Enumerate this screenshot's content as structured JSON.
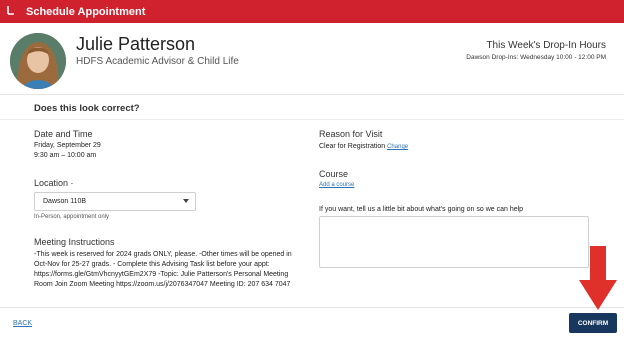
{
  "header": {
    "back_icon": "back-arrow-icon",
    "title": "Schedule Appointment",
    "color": "#d0222e"
  },
  "advisor": {
    "name": "Julie Patterson",
    "role": "HDFS Academic Advisor & Child Life",
    "drop_in_title": "This Week's Drop-In Hours",
    "drop_in_detail": "Dawson Drop-Ins: Wednesday 10:00 - 12:00 PM"
  },
  "confirm_question": "Does this look correct?",
  "date_time": {
    "label": "Date and Time",
    "date": "Friday, September 29",
    "time": "9:30 am – 10:00 am"
  },
  "location": {
    "label": "Location ·",
    "selected": "Dawson 110B",
    "note": "In-Person, appointment only"
  },
  "meeting_instructions": {
    "label": "Meeting Instructions",
    "lines": [
      "-This week is reserved for 2024 grads ONLY, please. -Other times will be opened in",
      "Oct-Nov for 25-27 grads. - Complete this Advising Task list before your appt:",
      "https://forms.gle/GtmVhcnyytGEm2X79 -Topic: Julie Patterson's Personal Meeting",
      "Room Join Zoom Meeting https://zoom.us/j/2076347047 Meeting ID: 207 634 7047"
    ]
  },
  "reason": {
    "label": "Reason for Visit",
    "value": "Clear for Registration",
    "change_link": "Change"
  },
  "course": {
    "label": "Course",
    "add_link": "Add a course"
  },
  "notes_prompt": "If you want, tell us a little bit about what's going on so we can help",
  "footer": {
    "back_label": "BACK",
    "confirm_label": "CONFIRM",
    "confirm_color": "#17375e"
  },
  "annotation": {
    "arrow_color": "#e0302a"
  }
}
